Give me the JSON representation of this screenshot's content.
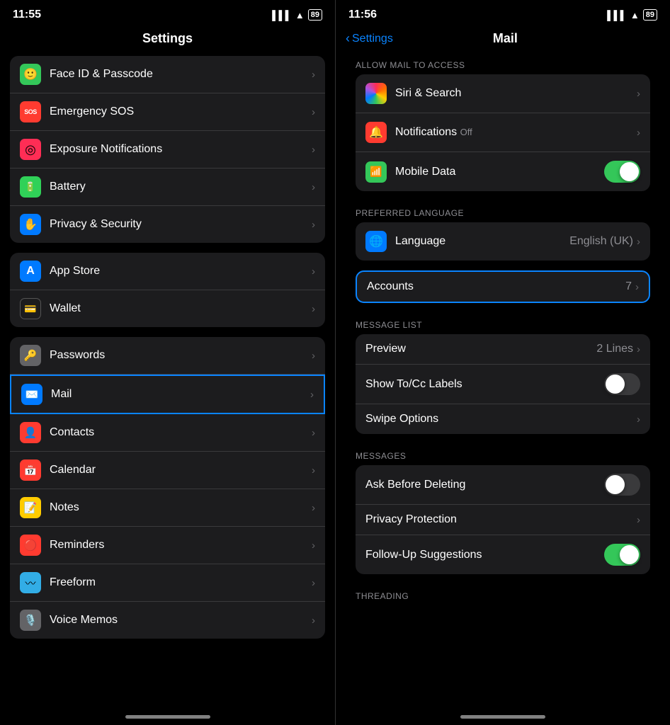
{
  "left": {
    "status": {
      "time": "11:55",
      "battery": "89"
    },
    "title": "Settings",
    "groups": [
      {
        "id": "security-group",
        "items": [
          {
            "id": "face-id",
            "icon": "🙂",
            "iconColor": "icon-green",
            "label": "Face ID & Passcode",
            "chevron": true
          },
          {
            "id": "emergency-sos",
            "icon": "SOS",
            "iconColor": "icon-red",
            "label": "Emergency SOS",
            "chevron": true,
            "iconFontSize": "9px"
          },
          {
            "id": "exposure",
            "icon": "◎",
            "iconColor": "icon-pink",
            "label": "Exposure Notifications",
            "chevron": true
          },
          {
            "id": "battery",
            "icon": "▬",
            "iconColor": "icon-green2",
            "label": "Battery",
            "chevron": true
          },
          {
            "id": "privacy",
            "icon": "✋",
            "iconColor": "icon-blue",
            "label": "Privacy & Security",
            "chevron": true
          }
        ]
      },
      {
        "id": "store-group",
        "items": [
          {
            "id": "app-store",
            "icon": "A",
            "iconColor": "icon-blue",
            "label": "App Store",
            "chevron": true
          },
          {
            "id": "wallet",
            "icon": "▤",
            "iconColor": "icon-dark-gray",
            "label": "Wallet",
            "chevron": true
          }
        ]
      },
      {
        "id": "apps-group",
        "items": [
          {
            "id": "passwords",
            "icon": "🔑",
            "iconColor": "icon-dark-gray",
            "label": "Passwords",
            "chevron": true
          },
          {
            "id": "mail",
            "icon": "✉",
            "iconColor": "icon-blue",
            "label": "Mail",
            "chevron": true,
            "selected": true
          },
          {
            "id": "contacts",
            "icon": "👤",
            "iconColor": "icon-orange-red",
            "label": "Contacts",
            "chevron": true
          },
          {
            "id": "calendar",
            "icon": "📅",
            "iconColor": "icon-red",
            "label": "Calendar",
            "chevron": true
          },
          {
            "id": "notes",
            "icon": "📝",
            "iconColor": "icon-yellow",
            "label": "Notes",
            "chevron": true
          },
          {
            "id": "reminders",
            "icon": "🔴",
            "iconColor": "icon-red",
            "label": "Reminders",
            "chevron": true
          },
          {
            "id": "freeform",
            "icon": "〰",
            "iconColor": "icon-teal",
            "label": "Freeform",
            "chevron": true
          },
          {
            "id": "voice-memos",
            "icon": "🎙",
            "iconColor": "icon-dark-gray",
            "label": "Voice Memos",
            "chevron": true
          }
        ]
      }
    ]
  },
  "right": {
    "status": {
      "time": "11:56",
      "battery": "89"
    },
    "back_label": "Settings",
    "title": "Mail",
    "sections": [
      {
        "id": "allow-mail-access",
        "header": "ALLOW MAIL TO ACCESS",
        "items": [
          {
            "id": "siri-search",
            "icon": "🌈",
            "iconColor": "icon-dark-gray",
            "label": "Siri & Search",
            "type": "chevron"
          },
          {
            "id": "notifications",
            "icon": "🔔",
            "iconColor": "icon-red",
            "label": "Notifications",
            "sublabel": "Off",
            "type": "chevron"
          },
          {
            "id": "mobile-data",
            "icon": "📶",
            "iconColor": "icon-green",
            "label": "Mobile Data",
            "type": "toggle",
            "value": true
          }
        ]
      },
      {
        "id": "preferred-language",
        "header": "PREFERRED LANGUAGE",
        "items": [
          {
            "id": "language",
            "icon": "🌐",
            "iconColor": "icon-blue",
            "label": "Language",
            "type": "value-chevron",
            "value": "English (UK)"
          }
        ]
      },
      {
        "id": "accounts",
        "header": "",
        "highlighted": true,
        "items": [
          {
            "id": "accounts-row",
            "label": "Accounts",
            "type": "value-chevron",
            "value": "7"
          }
        ]
      },
      {
        "id": "message-list",
        "header": "MESSAGE LIST",
        "items": [
          {
            "id": "preview",
            "label": "Preview",
            "type": "value-chevron",
            "value": "2 Lines"
          },
          {
            "id": "show-tocc",
            "label": "Show To/Cc Labels",
            "type": "toggle",
            "value": false
          },
          {
            "id": "swipe-options",
            "label": "Swipe Options",
            "type": "chevron"
          }
        ]
      },
      {
        "id": "messages",
        "header": "MESSAGES",
        "items": [
          {
            "id": "ask-before-deleting",
            "label": "Ask Before Deleting",
            "type": "toggle",
            "value": false
          },
          {
            "id": "privacy-protection",
            "label": "Privacy Protection",
            "type": "chevron"
          },
          {
            "id": "follow-up",
            "label": "Follow-Up Suggestions",
            "type": "toggle",
            "value": true
          }
        ]
      },
      {
        "id": "threading",
        "header": "THREADING",
        "items": []
      }
    ]
  }
}
